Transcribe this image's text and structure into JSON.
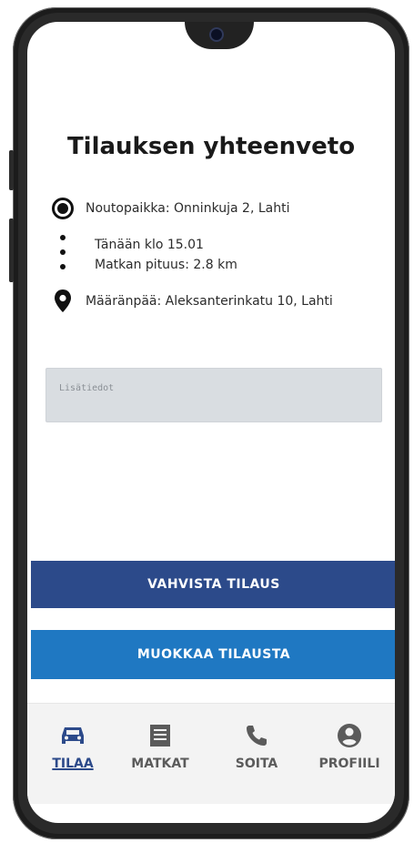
{
  "screen": {
    "title": "Tilauksen yhteenveto",
    "pickup": {
      "label": "Noutopaikka: Onninkuja 2, Lahti",
      "icon": "radio-target-icon"
    },
    "info": {
      "time": "Tänään klo 15.01",
      "distance": "Matkan pituus: 2.8 km",
      "icon": "vertical-dots-icon"
    },
    "destination": {
      "label": "Määränpää: Aleksanterinkatu 10, Lahti",
      "icon": "location-pin-icon"
    },
    "notes": {
      "placeholder": "Lisätiedot"
    },
    "buttons": {
      "confirm": "VAHVISTA TILAUS",
      "edit": "MUOKKAA TILAUSTA"
    }
  },
  "bottom_nav": {
    "items": [
      {
        "label": "TILAA",
        "icon": "car-icon",
        "active": true
      },
      {
        "label": "MATKAT",
        "icon": "list-icon"
      },
      {
        "label": "SOITA",
        "icon": "phone-icon"
      },
      {
        "label": "PROFIILI",
        "icon": "user-icon"
      }
    ]
  },
  "colors": {
    "confirm_button": "#2c4a8a",
    "edit_button": "#1f78c2",
    "notes_bg": "#d9dde1",
    "nav_active": "#2c4a8a"
  }
}
